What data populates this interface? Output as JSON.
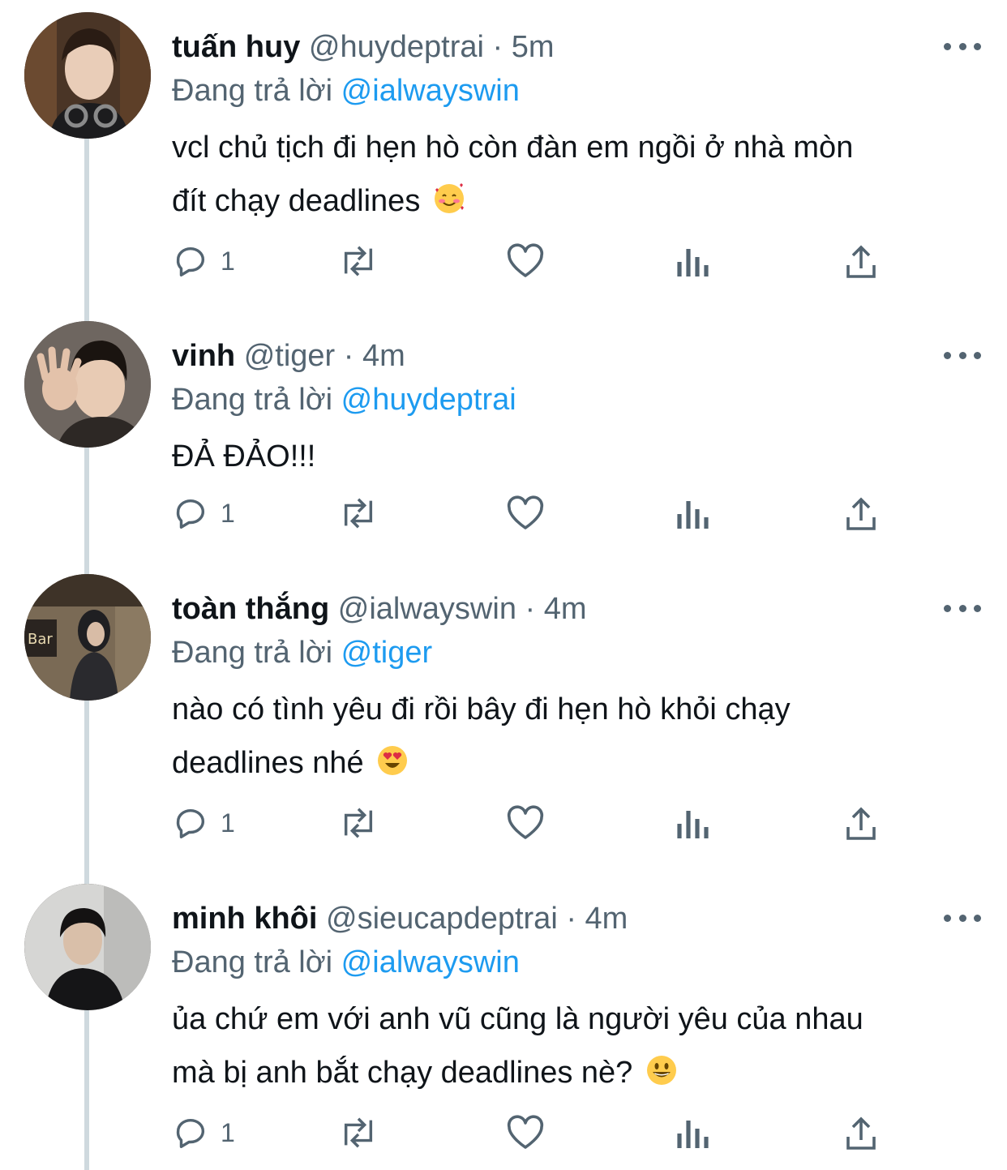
{
  "reply_prefix": "Đang trả lời",
  "colors": {
    "link": "#1d9bf0",
    "meta": "#536471",
    "text": "#0f1419",
    "thread_line": "#cfd9de"
  },
  "tweets": [
    {
      "name": "tuấn huy",
      "handle": "@huydeptrai",
      "separator": "·",
      "time": "5m",
      "reply_to": "@ialwayswin",
      "lines": [
        "vcl chủ tịch đi hẹn hò còn đàn em ngồi ở nhà mòn",
        "đít chạy deadlines"
      ],
      "emoji": "smiling-face-with-hearts",
      "reply_count": "1"
    },
    {
      "name": "vinh",
      "handle": "@tiger",
      "separator": "·",
      "time": "4m",
      "reply_to": "@huydeptrai",
      "lines": [
        "ĐẢ ĐẢO!!!"
      ],
      "reply_count": "1"
    },
    {
      "name": "toàn thắng",
      "handle": "@ialwayswin",
      "separator": "·",
      "time": "4m",
      "reply_to": "@tiger",
      "lines": [
        "nào có tình yêu đi rồi bây đi hẹn hò khỏi chạy",
        "deadlines nhé"
      ],
      "emoji": "heart-eyes",
      "reply_count": "1"
    },
    {
      "name": "minh khôi",
      "handle": "@sieucapdeptrai",
      "separator": "·",
      "time": "4m",
      "reply_to": "@ialwayswin",
      "lines": [
        "ủa chứ em với anh vũ cũng là người yêu của nhau",
        "mà bị anh bắt chạy deadlines nè?"
      ],
      "emoji": "grinning-face",
      "reply_count": "1"
    }
  ]
}
